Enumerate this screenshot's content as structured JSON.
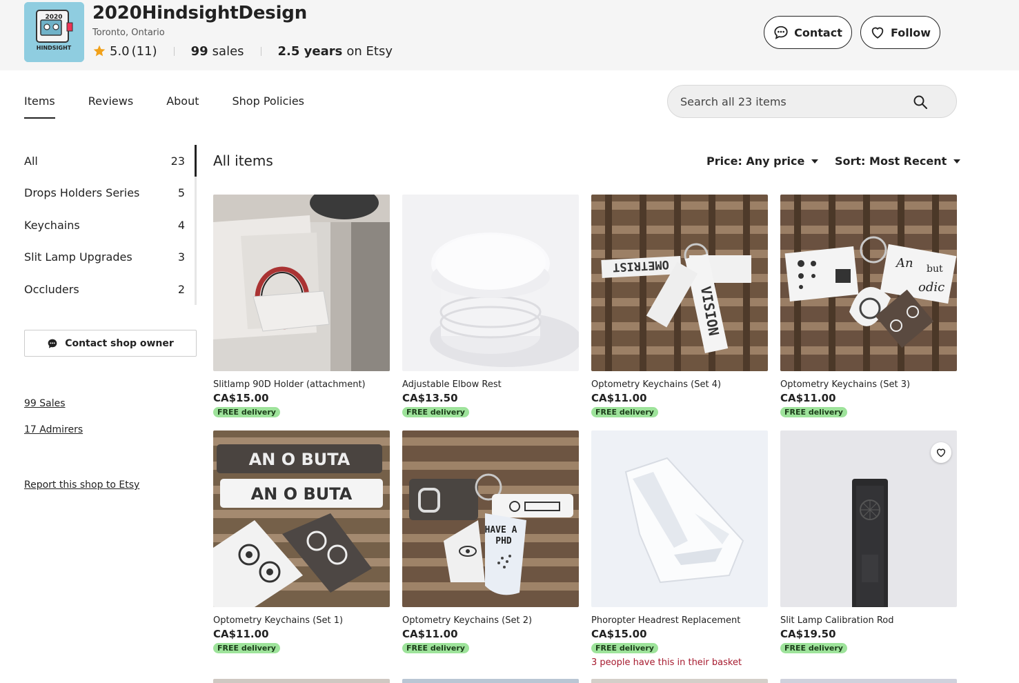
{
  "shop": {
    "logo_text_top": "2020",
    "logo_text_bottom": "HINDSIGHT",
    "name": "2020HindsightDesign",
    "location": "Toronto, Ontario",
    "rating": "5.0",
    "review_count": "(11)",
    "sales_count": "99",
    "sales_label": "sales",
    "years": "2.5 years",
    "years_suffix": "on Etsy"
  },
  "header_buttons": {
    "contact": "Contact",
    "follow": "Follow"
  },
  "nav": {
    "tabs": [
      {
        "label": "Items",
        "active": true
      },
      {
        "label": "Reviews",
        "active": false
      },
      {
        "label": "About",
        "active": false
      },
      {
        "label": "Shop Policies",
        "active": false
      }
    ],
    "search_placeholder": "Search all 23 items"
  },
  "sidebar": {
    "sections": [
      {
        "label": "All",
        "count": "23"
      },
      {
        "label": "Drops Holders Series",
        "count": "5"
      },
      {
        "label": "Keychains",
        "count": "4"
      },
      {
        "label": "Slit Lamp Upgrades",
        "count": "3"
      },
      {
        "label": "Occluders",
        "count": "2"
      }
    ],
    "contact_owner": "Contact shop owner",
    "sales_link": "99 Sales",
    "admirers_link": "17 Admirers",
    "report_link": "Report this shop to Etsy"
  },
  "main": {
    "heading": "All items",
    "price_filter": "Price: Any price",
    "sort_filter": "Sort: Most Recent"
  },
  "listings": [
    {
      "title": "Slitlamp 90D Holder (attachment)",
      "price": "CA$15.00",
      "badge": "FREE delivery"
    },
    {
      "title": "Adjustable Elbow Rest",
      "price": "CA$13.50",
      "badge": "FREE delivery"
    },
    {
      "title": "Optometry Keychains (Set 4)",
      "price": "CA$11.00",
      "badge": "FREE delivery"
    },
    {
      "title": "Optometry Keychains (Set 3)",
      "price": "CA$11.00",
      "badge": "FREE delivery"
    },
    {
      "title": "Optometry Keychains (Set 1)",
      "price": "CA$11.00",
      "badge": "FREE delivery"
    },
    {
      "title": "Optometry Keychains (Set 2)",
      "price": "CA$11.00",
      "badge": "FREE delivery"
    },
    {
      "title": "Phoropter Headrest Replacement",
      "price": "CA$15.00",
      "badge": "FREE delivery",
      "note": "3 people have this in their basket"
    },
    {
      "title": "Slit Lamp Calibration Rod",
      "price": "CA$19.50",
      "badge": "FREE delivery"
    }
  ],
  "photo_text": {
    "set4_a": "OMETRIST",
    "set4_b": "VISION",
    "set1_a": "AN  O  BUTA",
    "set2_a": "HAVE A",
    "set2_b": "PHD",
    "set3_a": "An",
    "set3_b": "but",
    "set3_c": "odic"
  },
  "colors": {
    "header_bg": "#f5f5f5",
    "badge_green": "#9ee39b",
    "star": "#f1a11a",
    "basket_note": "#a61a2e",
    "logo_bg": "#8fcde0"
  }
}
